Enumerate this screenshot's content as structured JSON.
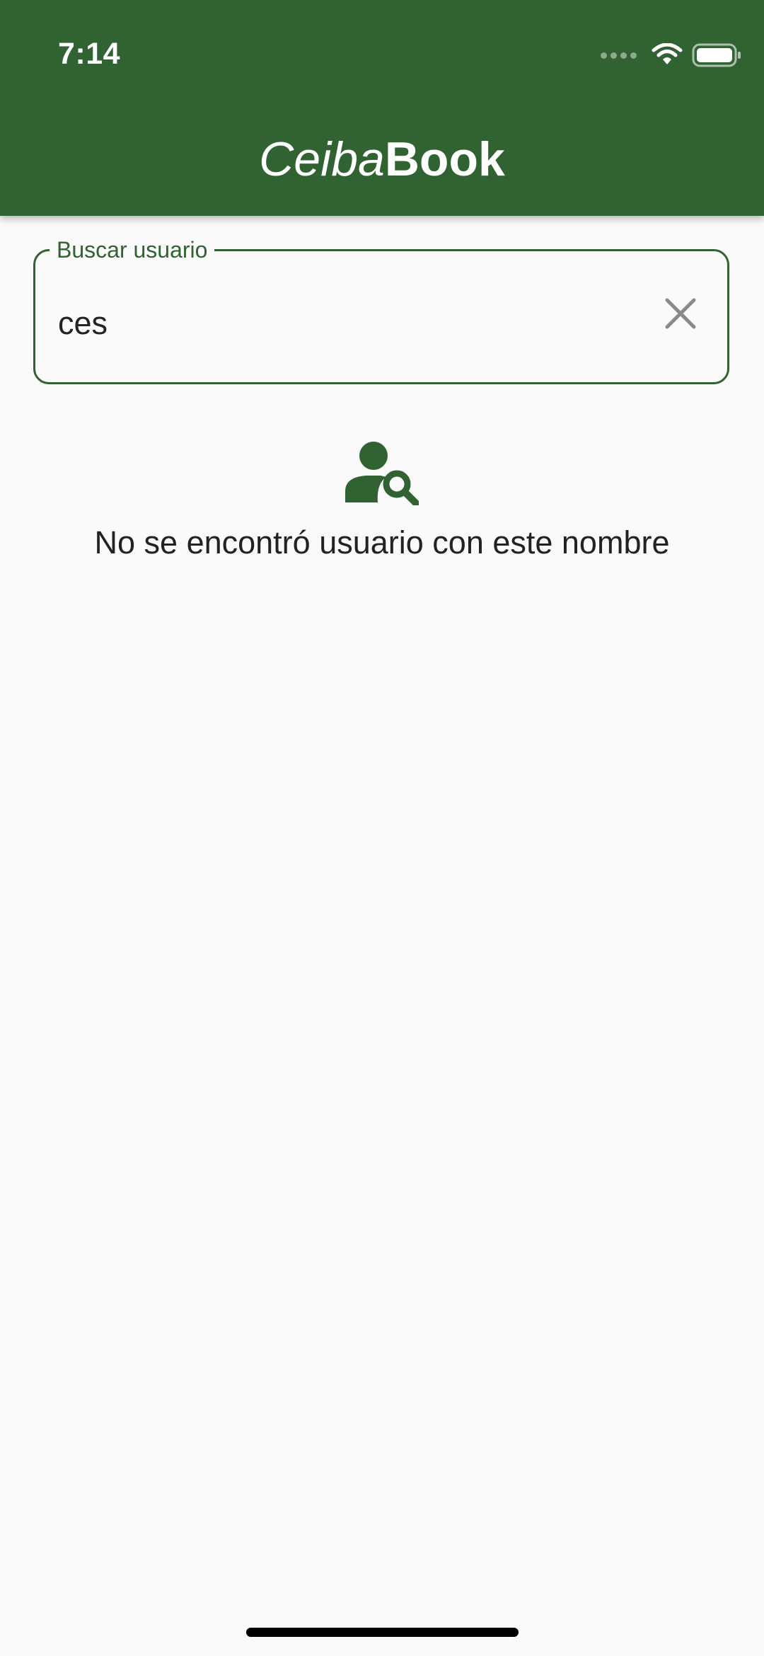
{
  "status_bar": {
    "time": "7:14"
  },
  "app_bar": {
    "title_italic": "Ceiba",
    "title_bold": "Book",
    "color": "#306232"
  },
  "search": {
    "label": "Buscar usuario",
    "value": "ces"
  },
  "empty_state": {
    "icon": "person-search-icon",
    "message": "No se encontró usuario con este nombre"
  }
}
